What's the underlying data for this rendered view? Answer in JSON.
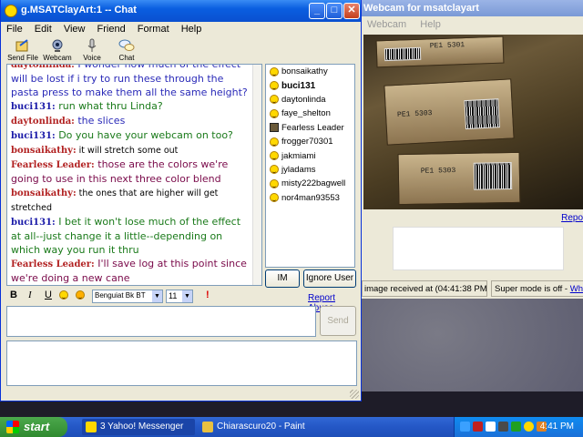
{
  "chat_window": {
    "title": "g.MSATClayArt:1 -- Chat",
    "controls": {
      "minimize": "_",
      "maximize": "□",
      "close": "✕"
    },
    "menu": [
      "File",
      "Edit",
      "View",
      "Friend",
      "Format",
      "Help"
    ],
    "toolbar": [
      {
        "label": "Send File",
        "icon": "send-file-icon"
      },
      {
        "label": "Webcam",
        "icon": "webcam-icon"
      },
      {
        "label": "Voice",
        "icon": "voice-icon"
      },
      {
        "label": "Chat",
        "icon": "chat-icon"
      }
    ],
    "messages": [
      {
        "name": "daytonlinda:",
        "text": " I wonder how much of the effect will be lost if i try to run these through the pasta press to make them all the same height?",
        "name_color": "#b22222",
        "text_color": "#2a2ab8"
      },
      {
        "name": "buci131:",
        "text": " run what thru Linda?",
        "name_color": "#1a1aa8",
        "text_color": "#1a7a1a"
      },
      {
        "name": "daytonlinda:",
        "text": " the slices",
        "name_color": "#b22222",
        "text_color": "#2a2ab8"
      },
      {
        "name": "buci131:",
        "text": " Do you have your webcam on too?",
        "name_color": "#1a1aa8",
        "text_color": "#1a7a1a"
      },
      {
        "name": "bonsaikathy:",
        "text": " it will stretch some out",
        "name_color": "#b22222",
        "text_color": "#000000",
        "small": true
      },
      {
        "name": "Fearless Leader:",
        "text": " those are the colors we're going to use in this next three color blend",
        "name_color": "#b22222",
        "text_color": "#7a0a4a"
      },
      {
        "name": "bonsaikathy:",
        "text": " the ones that are higher will get stretched",
        "name_color": "#b22222",
        "text_color": "#000000",
        "small": true
      },
      {
        "name": "buci131:",
        "text": " I bet it won't lose much of the effect at all--just change it a little--depending on which way you run it thru",
        "name_color": "#1a1aa8",
        "text_color": "#1a7a1a"
      },
      {
        "name": "Fearless Leader:",
        "text": " I'll save log at this point since we're doing a new cane",
        "name_color": "#b22222",
        "text_color": "#7a0a4a"
      }
    ],
    "buddies": [
      {
        "name": "bonsaikathy",
        "icon": "smiley"
      },
      {
        "name": "buci131",
        "icon": "smiley",
        "self": true
      },
      {
        "name": "daytonlinda",
        "icon": "smiley"
      },
      {
        "name": "faye_shelton",
        "icon": "smiley"
      },
      {
        "name": "Fearless Leader",
        "icon": "leader"
      },
      {
        "name": "frogger70301",
        "icon": "smiley"
      },
      {
        "name": "jakmiami",
        "icon": "smiley"
      },
      {
        "name": "jyladams",
        "icon": "smiley"
      },
      {
        "name": "misty222bagwell",
        "icon": "smiley",
        "selected": true
      },
      {
        "name": "nor4man93553",
        "icon": "smiley"
      }
    ],
    "im_button": "IM",
    "ignore_button": "Ignore User",
    "format": {
      "bold": "B",
      "italic": "I",
      "underline": "U",
      "font": "Benguiat Bk BT",
      "size": "11"
    },
    "report_abuse": "Report Abuse",
    "send_button": "Send"
  },
  "webcam_window": {
    "title": "Webcam for msatclayart",
    "menu": [
      "Webcam",
      "Help"
    ],
    "labels": [
      "PE1 5301",
      "PE1 5303",
      "PE1 5303"
    ],
    "report_link": "Repo",
    "status_left": "image received at (04:41:38 PM)",
    "status_right_text": "Super mode is off - ",
    "status_right_link": "What"
  },
  "taskbar": {
    "start": "start",
    "tasks": [
      {
        "label": "3 Yahoo! Messenger",
        "icon": "yahoo-messenger-icon"
      },
      {
        "label": "Chiarascuro20 - Paint",
        "icon": "paint-icon"
      }
    ],
    "clock": "4:41 PM"
  },
  "colors": {
    "title_blue": "#0a5ee0",
    "taskbar_blue": "#2457c6",
    "start_green": "#3c9a3c"
  }
}
